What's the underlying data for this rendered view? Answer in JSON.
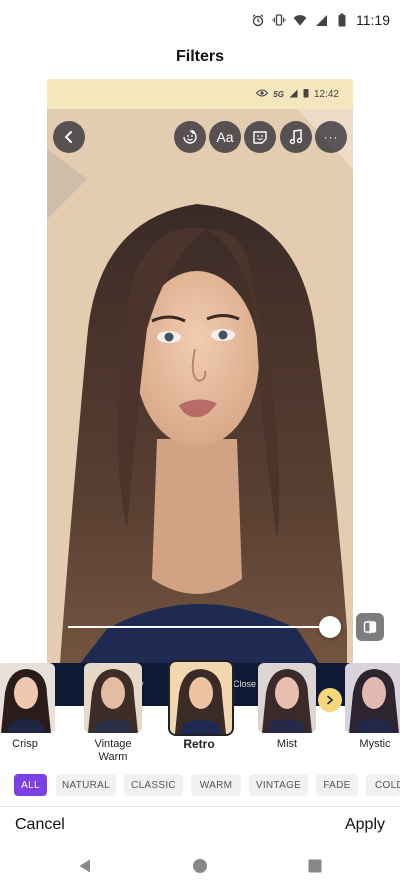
{
  "status_bar": {
    "time": "11:19"
  },
  "header": {
    "title": "Filters"
  },
  "preview": {
    "status_bar": {
      "network": "5G",
      "time": "12:42"
    },
    "tools": [
      {
        "name": "back",
        "icon": "chevron-left-icon"
      },
      {
        "name": "sticker",
        "icon": "sticker-icon"
      },
      {
        "name": "text",
        "icon": "text-icon",
        "label": "Aa"
      },
      {
        "name": "emoji",
        "icon": "emoji-icon"
      },
      {
        "name": "music",
        "icon": "music-icon"
      },
      {
        "name": "more",
        "icon": "more-icon",
        "label": "···"
      }
    ],
    "underlay_text": {
      "left": "y",
      "right": "Close F"
    }
  },
  "intensity_slider": {
    "value": 1.0
  },
  "filters": [
    {
      "label": "Crisp"
    },
    {
      "label": "Vintage\nWarm"
    },
    {
      "label": "Retro",
      "selected": true
    },
    {
      "label": "Mist"
    },
    {
      "label": "Mystic"
    }
  ],
  "categories": [
    {
      "label": "ALL",
      "active": true
    },
    {
      "label": "NATURAL"
    },
    {
      "label": "CLASSIC"
    },
    {
      "label": "WARM"
    },
    {
      "label": "VINTAGE"
    },
    {
      "label": "FADE"
    },
    {
      "label": "COLD"
    }
  ],
  "footer": {
    "cancel": "Cancel",
    "apply": "Apply"
  },
  "colors": {
    "accent": "#7b3fe4",
    "next_button": "#f3d77b"
  }
}
